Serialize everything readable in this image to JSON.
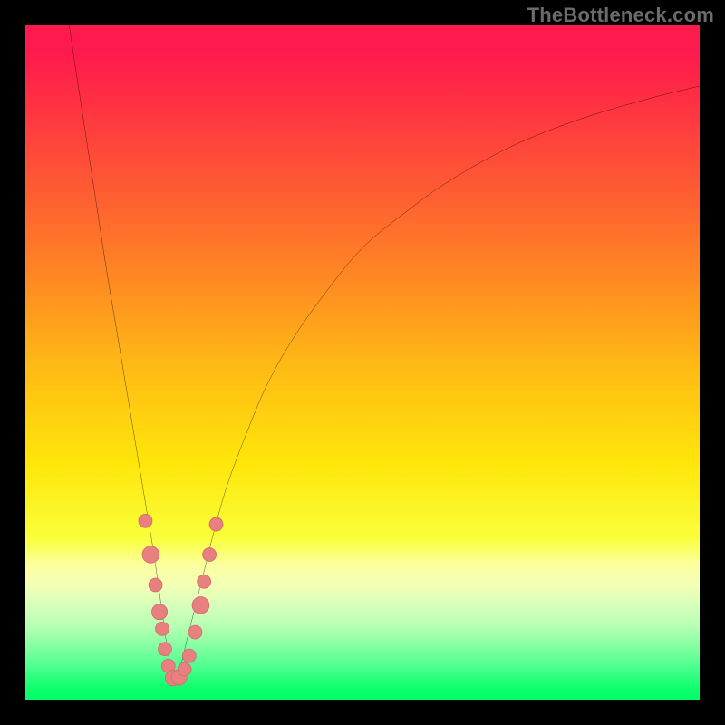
{
  "watermark_text": "TheBottleneck.com",
  "colors": {
    "background_frame": "#000000",
    "curve_stroke": "#000000",
    "marker_fill": "#e8807f",
    "marker_stroke": "#d46c6e"
  },
  "chart_data": {
    "type": "line",
    "title": "",
    "xlabel": "",
    "ylabel": "",
    "xlim": [
      0,
      100
    ],
    "ylim": [
      0,
      100
    ],
    "note": "No numeric axes, ticks, or labels are rendered; coordinates are normalized percentages of the plot area (x left→right, y bottom→top). Curve shows a steep V-well near x≈22 with a minimum at y≈3, then an asymptotic rise toward the right.",
    "series": [
      {
        "name": "bottleneck-curve",
        "x": [
          6.5,
          8,
          10,
          12,
          14,
          16,
          17,
          18,
          19,
          20,
          21,
          22,
          23,
          24,
          25,
          26,
          27,
          28,
          30,
          33,
          36,
          40,
          45,
          50,
          56,
          63,
          72,
          82,
          92,
          100
        ],
        "y": [
          100,
          90,
          77,
          64,
          52,
          40,
          34,
          28,
          22,
          15,
          8,
          3,
          5,
          9,
          13,
          17,
          21,
          25,
          32,
          40,
          47,
          54,
          61,
          67,
          72,
          77,
          82,
          86,
          89,
          91
        ]
      }
    ],
    "markers": [
      {
        "x": 17.8,
        "y": 26.5,
        "r": 1.0
      },
      {
        "x": 18.6,
        "y": 21.5,
        "r": 1.25
      },
      {
        "x": 19.3,
        "y": 17.0,
        "r": 1.0
      },
      {
        "x": 19.9,
        "y": 13.0,
        "r": 1.15
      },
      {
        "x": 20.3,
        "y": 10.5,
        "r": 1.0
      },
      {
        "x": 20.7,
        "y": 7.5,
        "r": 1.0
      },
      {
        "x": 21.2,
        "y": 5.0,
        "r": 1.0
      },
      {
        "x": 21.9,
        "y": 3.2,
        "r": 1.15
      },
      {
        "x": 22.8,
        "y": 3.3,
        "r": 1.15
      },
      {
        "x": 23.6,
        "y": 4.5,
        "r": 1.0
      },
      {
        "x": 24.3,
        "y": 6.5,
        "r": 1.0
      },
      {
        "x": 25.2,
        "y": 10.0,
        "r": 1.0
      },
      {
        "x": 26.0,
        "y": 14.0,
        "r": 1.25
      },
      {
        "x": 26.5,
        "y": 17.5,
        "r": 1.0
      },
      {
        "x": 27.3,
        "y": 21.5,
        "r": 1.0
      },
      {
        "x": 28.3,
        "y": 26.0,
        "r": 1.0
      }
    ],
    "gradient_stops": [
      {
        "pos": 0.0,
        "color": "#ff1a4d"
      },
      {
        "pos": 0.5,
        "color": "#ffe60a"
      },
      {
        "pos": 0.82,
        "color": "#f4ffb5"
      },
      {
        "pos": 1.0,
        "color": "#00ff67"
      }
    ]
  }
}
